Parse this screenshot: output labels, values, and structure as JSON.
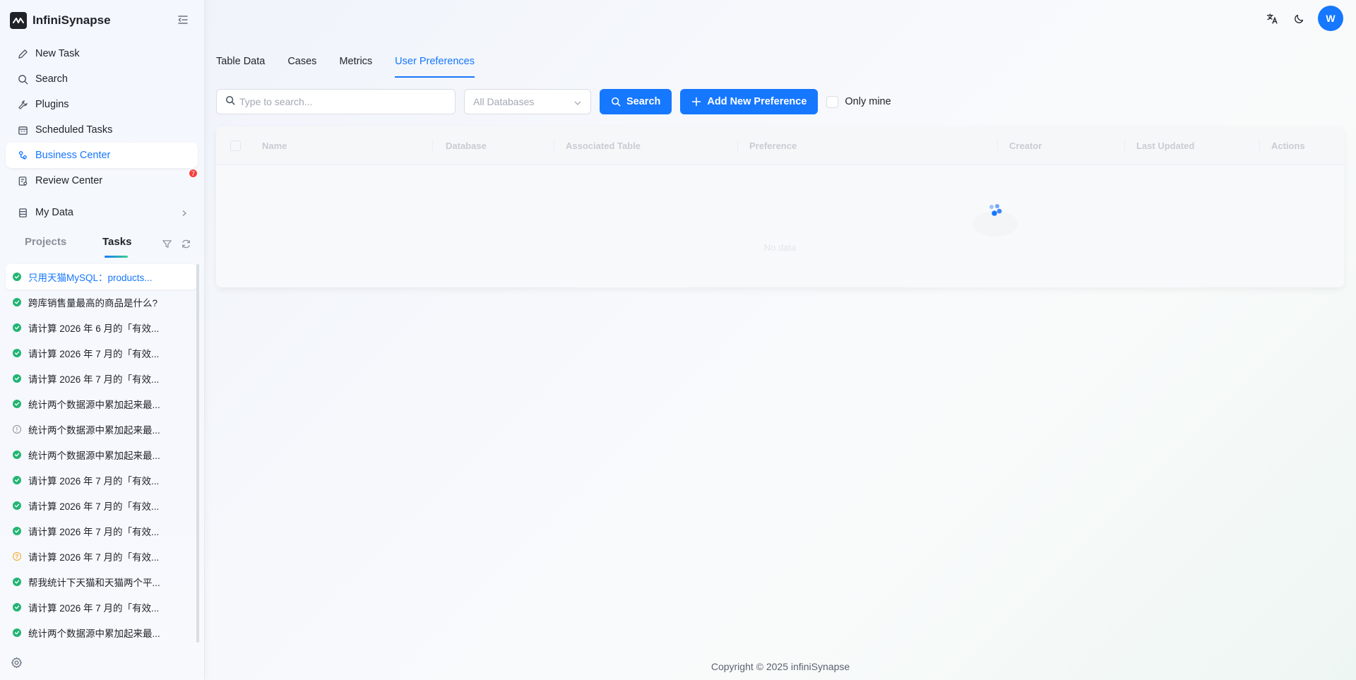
{
  "app": {
    "name": "InfiniSynapse"
  },
  "nav": [
    {
      "label": "New Task",
      "icon": "edit-icon"
    },
    {
      "label": "Search",
      "icon": "search-icon"
    },
    {
      "label": "Plugins",
      "icon": "wrench-icon"
    },
    {
      "label": "Scheduled Tasks",
      "icon": "calendar-icon"
    },
    {
      "label": "Business Center",
      "icon": "business-icon",
      "active": true
    },
    {
      "label": "Review Center",
      "icon": "review-icon",
      "badge": "7"
    },
    {
      "label": "My Data",
      "icon": "database-icon"
    }
  ],
  "sidebar_tabs": {
    "projects": "Projects",
    "tasks": "Tasks"
  },
  "tasks": [
    {
      "label": "只用天猫MySQL：products...",
      "status": "ok",
      "active": true
    },
    {
      "label": "跨库销售量最高的商品是什么?",
      "status": "ok"
    },
    {
      "label": "请计算 2026 年 6 月的「有效...",
      "status": "ok"
    },
    {
      "label": "请计算 2026 年 7 月的「有效...",
      "status": "ok"
    },
    {
      "label": "请计算 2026 年 7 月的「有效...",
      "status": "ok"
    },
    {
      "label": "统计两个数据源中累加起来最...",
      "status": "ok"
    },
    {
      "label": "统计两个数据源中累加起来最...",
      "status": "info"
    },
    {
      "label": "统计两个数据源中累加起来最...",
      "status": "ok"
    },
    {
      "label": "请计算 2026 年 7 月的「有效...",
      "status": "ok"
    },
    {
      "label": "请计算 2026 年 7 月的「有效...",
      "status": "ok"
    },
    {
      "label": "请计算 2026 年 7 月的「有效...",
      "status": "ok"
    },
    {
      "label": "请计算 2026 年 7 月的「有效...",
      "status": "warn"
    },
    {
      "label": "帮我统计下天猫和天猫两个平...",
      "status": "ok"
    },
    {
      "label": "请计算 2026 年 7 月的「有效...",
      "status": "ok"
    },
    {
      "label": "统计两个数据源中累加起来最...",
      "status": "ok"
    }
  ],
  "header": {
    "avatar": "W"
  },
  "main_tabs": [
    {
      "label": "Table Data"
    },
    {
      "label": "Cases"
    },
    {
      "label": "Metrics"
    },
    {
      "label": "User Preferences",
      "active": true
    }
  ],
  "toolbar": {
    "search_placeholder": "Type to search...",
    "search_value": "",
    "db_select": "All Databases",
    "search_button": "Search",
    "add_button": "Add New Preference",
    "only_mine": "Only mine"
  },
  "table": {
    "columns": [
      "Name",
      "Database",
      "Associated Table",
      "Preference",
      "Creator",
      "Last Updated",
      "Actions"
    ],
    "empty_text": "No data"
  },
  "footer": {
    "copyright": "Copyright © 2025 infiniSynapse"
  },
  "colors": {
    "primary": "#1677ff",
    "success": "#22b573",
    "warning": "#f5a623",
    "badge": "#f5403b"
  }
}
